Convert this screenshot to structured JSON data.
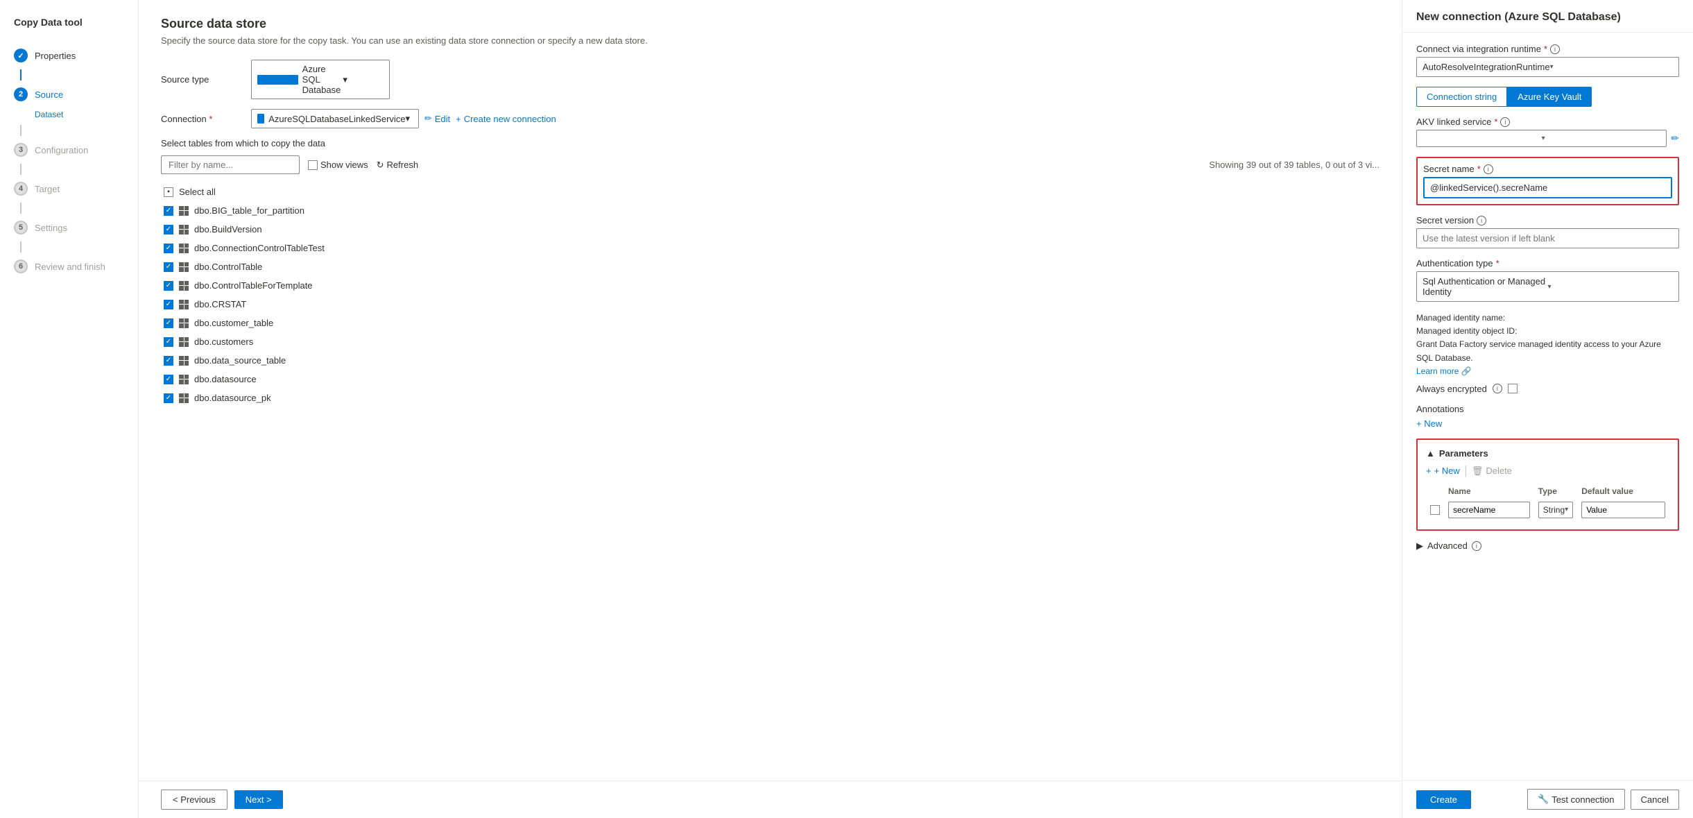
{
  "app": {
    "title": "Copy Data tool"
  },
  "nav": {
    "items": [
      {
        "id": "properties",
        "label": "Properties",
        "state": "done",
        "number": "✓"
      },
      {
        "id": "source",
        "label": "Source",
        "state": "active",
        "number": "2"
      },
      {
        "id": "dataset",
        "label": "Dataset",
        "state": "active-sub",
        "number": ""
      },
      {
        "id": "configuration",
        "label": "Configuration",
        "state": "inactive",
        "number": "3"
      },
      {
        "id": "target",
        "label": "Target",
        "state": "inactive",
        "number": "4"
      },
      {
        "id": "settings",
        "label": "Settings",
        "state": "inactive",
        "number": "5"
      },
      {
        "id": "review",
        "label": "Review and finish",
        "state": "inactive",
        "number": "6"
      }
    ]
  },
  "main": {
    "page_title": "Source data store",
    "page_subtitle": "Specify the source data store for the copy task. You can use an existing data store connection or specify a new data store.",
    "source_type_label": "Source type",
    "source_type_value": "Azure SQL Database",
    "connection_label": "Connection",
    "connection_value": "AzureSQLDatabaseLinkedService",
    "edit_label": "Edit",
    "create_connection_label": "Create new connection",
    "tables_title": "Select tables from which to copy the data",
    "filter_placeholder": "Filter by name...",
    "show_views_label": "Show views",
    "refresh_label": "Refresh",
    "showing_text": "Showing 39 out of 39 tables, 0 out of 3 vi...",
    "select_all_label": "Select all",
    "tables": [
      "dbo.BIG_table_for_partition",
      "dbo.BuildVersion",
      "dbo.ConnectionControlTableTest",
      "dbo.ControlTable",
      "dbo.ControlTableForTemplate",
      "dbo.CRSTAT",
      "dbo.customer_table",
      "dbo.customers",
      "dbo.data_source_table",
      "dbo.datasource",
      "dbo.datasource_pk"
    ],
    "prev_label": "< Previous",
    "next_label": "Next >"
  },
  "panel": {
    "title": "New connection (Azure SQL Database)",
    "connect_via_label": "Connect via integration runtime",
    "connect_via_required": true,
    "connect_via_value": "AutoResolveIntegrationRuntime",
    "tab_connection_string": "Connection string",
    "tab_azure_key_vault": "Azure Key Vault",
    "active_tab": "Azure Key Vault",
    "akv_linked_label": "AKV linked service",
    "akv_linked_required": true,
    "akv_linked_value": "",
    "secret_name_label": "Secret name",
    "secret_name_required": true,
    "secret_name_value": "@linkedService().secreName",
    "secret_version_label": "Secret version",
    "secret_version_placeholder": "Use the latest version if left blank",
    "auth_type_label": "Authentication type",
    "auth_type_required": true,
    "auth_type_value": "Sql Authentication or Managed Identity",
    "auth_info_line1": "Managed identity name:",
    "auth_info_line2": "Managed identity object ID:",
    "auth_info_line3": "Grant Data Factory service managed identity access to your Azure SQL Database.",
    "learn_more_label": "Learn more",
    "always_encrypted_label": "Always encrypted",
    "annotations_label": "Annotations",
    "add_new_label": "+ New",
    "params_section_label": "Parameters",
    "params_new_label": "+ New",
    "params_delete_label": "Delete",
    "params_col_name": "Name",
    "params_col_type": "Type",
    "params_col_default": "Default value",
    "params_row": {
      "name": "secreName",
      "type": "String",
      "default": "Value"
    },
    "advanced_label": "Advanced",
    "create_label": "Create",
    "test_connection_label": "Test connection",
    "cancel_label": "Cancel"
  }
}
